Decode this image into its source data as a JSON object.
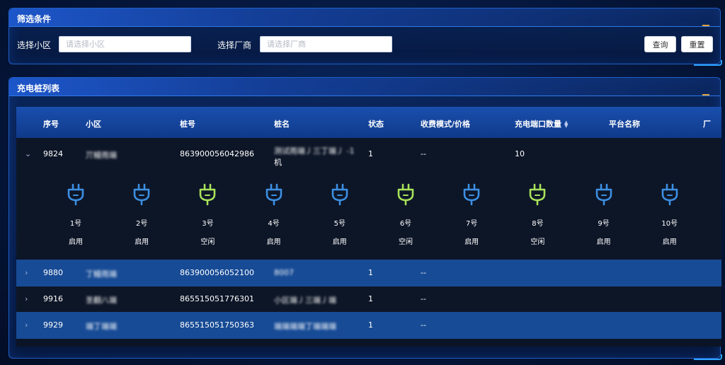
{
  "colors": {
    "busy": "#3d8fe3",
    "idle": "#a8e25a"
  },
  "filter": {
    "title": "筛选条件",
    "community_label": "选择小区",
    "community_placeholder": "请选择小区",
    "vendor_label": "选择厂商",
    "vendor_placeholder": "请选择厂商",
    "query_label": "查询",
    "reset_label": "重置"
  },
  "list": {
    "title": "充电桩列表",
    "columns": [
      "序号",
      "小区",
      "桩号",
      "桩名",
      "状态",
      "收费模式/价格",
      "充电端口数量",
      "平台名称",
      "厂"
    ],
    "rows": [
      {
        "id": "9824",
        "community": "丌鳗雨端",
        "pile_no": "863900056042986",
        "pile_name_line1": "测试雨端丿三丁端丿 -1",
        "pile_name_line2": "机",
        "status": "1",
        "fee": "--",
        "ports": "10",
        "expanded": true
      },
      {
        "id": "9880",
        "community": "丁鳗雨端",
        "pile_no": "863900056052100",
        "pile_name_line1": "8007",
        "status": "1",
        "fee": "--"
      },
      {
        "id": "9916",
        "community": "圣翻八端",
        "pile_no": "865515051776301",
        "pile_name_line1": "小区端丿三端丿端",
        "status": "1",
        "fee": "--"
      },
      {
        "id": "9929",
        "community": "端丁端端",
        "pile_no": "865515051750363",
        "pile_name_line1": "端端端端丁端端端",
        "status": "1",
        "fee": "--"
      }
    ],
    "port_items": [
      {
        "num": "1号",
        "status": "启用",
        "state": "busy"
      },
      {
        "num": "2号",
        "status": "启用",
        "state": "busy"
      },
      {
        "num": "3号",
        "status": "空闲",
        "state": "idle"
      },
      {
        "num": "4号",
        "status": "启用",
        "state": "busy"
      },
      {
        "num": "5号",
        "status": "启用",
        "state": "busy"
      },
      {
        "num": "6号",
        "status": "空闲",
        "state": "idle"
      },
      {
        "num": "7号",
        "status": "启用",
        "state": "busy"
      },
      {
        "num": "8号",
        "status": "空闲",
        "state": "idle"
      },
      {
        "num": "9号",
        "status": "启用",
        "state": "busy"
      },
      {
        "num": "10号",
        "status": "启用",
        "state": "busy"
      }
    ]
  }
}
